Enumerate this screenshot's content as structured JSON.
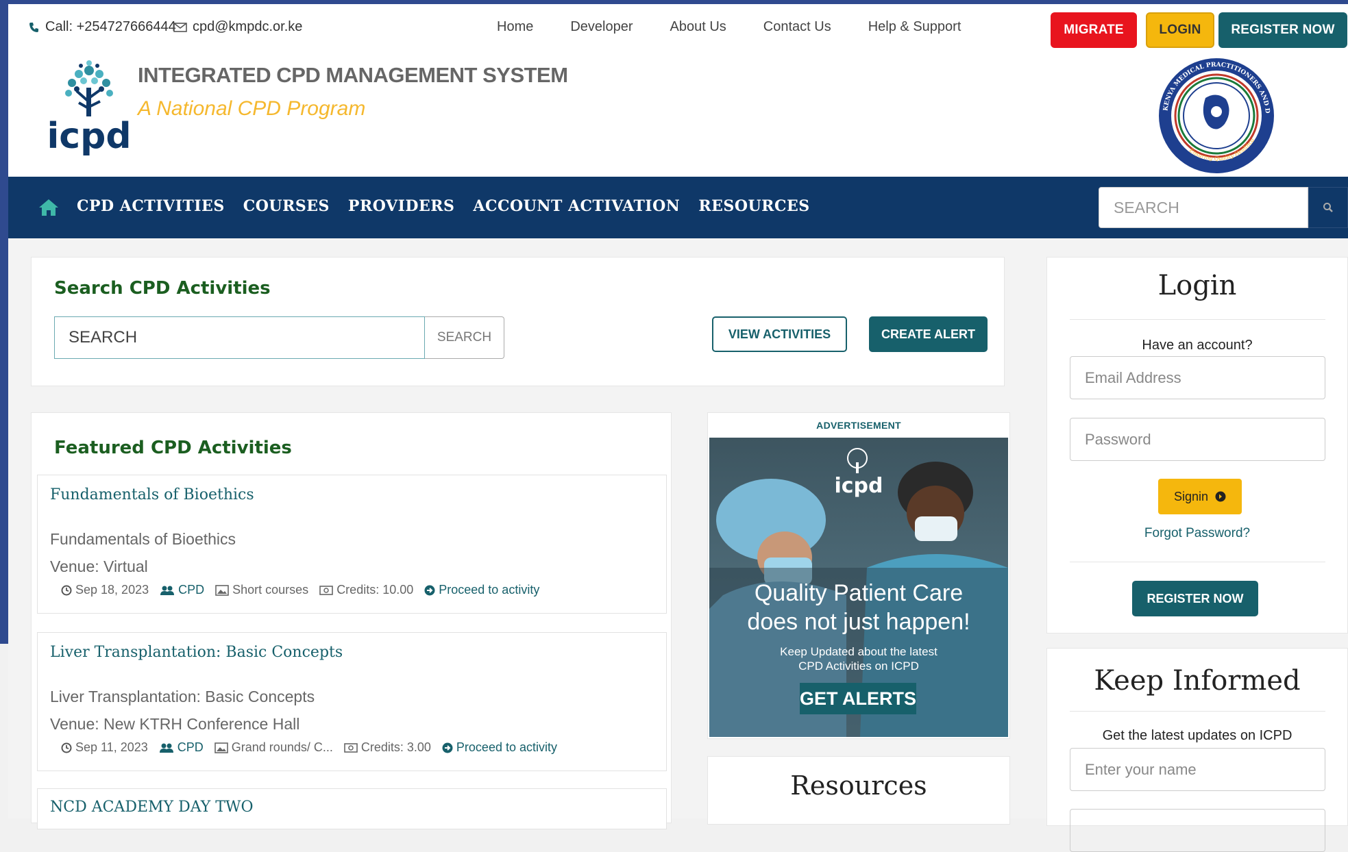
{
  "topbar": {
    "phone": "Call: +254727666444",
    "email": "cpd@kmpdc.or.ke",
    "links": [
      "Home",
      "Developer",
      "About Us",
      "Contact Us",
      "Help & Support"
    ],
    "migrate": "MIGRATE",
    "login": "LOGIN",
    "register": "REGISTER NOW"
  },
  "header": {
    "logo_text": "icpd",
    "title": "INTEGRATED CPD MANAGEMENT SYSTEM",
    "subtitle": "A National CPD Program",
    "seal_text": "KENYA MEDICAL PRACTITIONERS AND DENTISTS COUNCIL",
    "seal_motto": "Ensuring Quality Healthcare"
  },
  "nav": {
    "items": [
      "CPD ACTIVITIES",
      "COURSES",
      "PROVIDERS",
      "ACCOUNT ACTIVATION",
      "RESOURCES"
    ],
    "search_placeholder": "SEARCH"
  },
  "search_panel": {
    "heading": "Search CPD Activities",
    "placeholder": "SEARCH",
    "button": "SEARCH",
    "view_activities": "VIEW ACTIVITIES",
    "create_alert": "CREATE ALERT"
  },
  "featured": {
    "heading": "Featured CPD Activities",
    "activities": [
      {
        "title": "Fundamentals of Bioethics",
        "description": "Fundamentals of Bioethics",
        "venue": "Venue: Virtual",
        "date": "Sep 18, 2023",
        "type": "CPD",
        "category": "Short courses",
        "credits": "Credits: 10.00",
        "link": "Proceed to activity"
      },
      {
        "title": "Liver Transplantation: Basic Concepts",
        "description": "Liver Transplantation: Basic Concepts",
        "venue": "Venue: New KTRH Conference Hall",
        "date": "Sep 11, 2023",
        "type": "CPD",
        "category": "Grand rounds/ C...",
        "credits": "Credits: 3.00",
        "link": "Proceed to activity"
      },
      {
        "title": "NCD ACADEMY DAY TWO"
      }
    ]
  },
  "ad": {
    "label": "ADVERTISEMENT",
    "brand": "icpd",
    "headline_1": "Quality Patient Care",
    "headline_2": "does not just happen!",
    "small_1": "Keep Updated about the latest",
    "small_2": "CPD Activities on ICPD",
    "cta": "GET ALERTS"
  },
  "resources": {
    "heading": "Resources"
  },
  "login_panel": {
    "heading": "Login",
    "prompt": "Have an account?",
    "email_placeholder": "Email Address",
    "password_placeholder": "Password",
    "signin": "Signin",
    "forgot": "Forgot Password?",
    "register": "REGISTER NOW"
  },
  "keep_informed": {
    "heading": "Keep Informed",
    "prompt": "Get the latest updates on ICPD",
    "name_placeholder": "Enter your name"
  },
  "colors": {
    "nav_bg": "#0f3868",
    "teal": "#17606b",
    "migrate": "#e8141e",
    "login": "#f5b70d",
    "green_heading": "#1b5e20",
    "subtitle_yellow": "#f5b82e"
  }
}
